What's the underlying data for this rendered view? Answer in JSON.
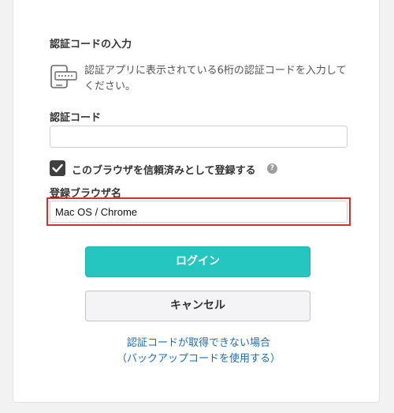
{
  "section_title": "認証コードの入力",
  "description": "認証アプリに表示されている6桁の認証コードを入力してください。",
  "code_field": {
    "label": "認証コード",
    "value": "",
    "placeholder": ""
  },
  "trust_checkbox": {
    "label": "このブラウザを信頼済みとして登録する",
    "checked": true,
    "help_icon": "?"
  },
  "browser_field": {
    "label": "登録ブラウザ名",
    "value": "Mac OS / Chrome"
  },
  "buttons": {
    "login": "ログイン",
    "cancel": "キャンセル"
  },
  "backup_link": {
    "line1": "認証コードが取得できない場合",
    "line2": "（バックアップコードを使用する）"
  },
  "colors": {
    "login_button": "#26c6c0",
    "link": "#1a6db3",
    "highlight": "#d32f2f"
  }
}
